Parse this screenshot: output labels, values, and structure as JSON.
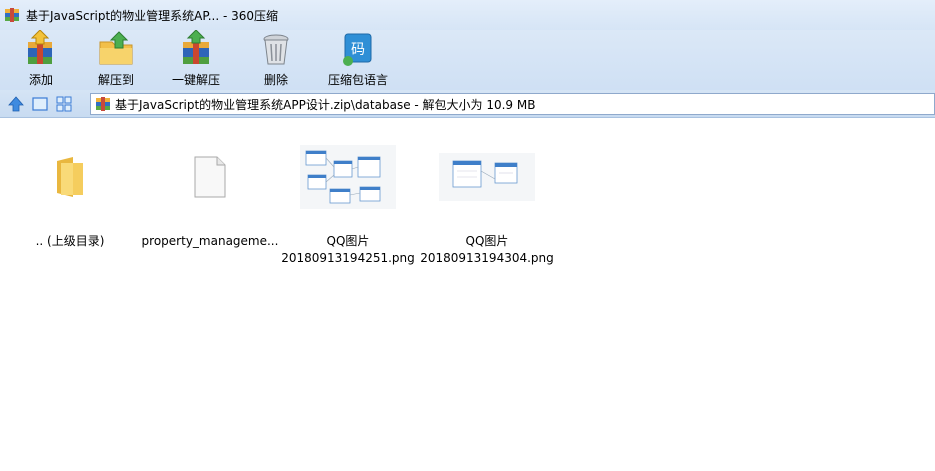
{
  "window": {
    "title": "基于JavaScript的物业管理系统AP... - 360压缩"
  },
  "toolbar": {
    "items": [
      {
        "label": "添加",
        "icon": "add-archive-icon"
      },
      {
        "label": "解压到",
        "icon": "extract-to-icon"
      },
      {
        "label": "一键解压",
        "icon": "one-click-extract-icon"
      },
      {
        "label": "删除",
        "icon": "delete-icon"
      },
      {
        "label": "压缩包语言",
        "icon": "archive-language-icon"
      }
    ]
  },
  "address": {
    "path": "基于JavaScript的物业管理系统APP设计.zip\\database - 解包大小为 10.9 MB"
  },
  "files": [
    {
      "line1": ".. (上级目录)",
      "line2": "",
      "type": "folder"
    },
    {
      "line1": "property_manageme...",
      "line2": "",
      "type": "document"
    },
    {
      "line1": "QQ图片",
      "line2": "20180913194251.png",
      "type": "image"
    },
    {
      "line1": "QQ图片",
      "line2": "20180913194304.png",
      "type": "image"
    }
  ],
  "colors": {
    "toolbar_bg": "#d6e5f6",
    "address_border": "#8fa9cc",
    "folder_yellow": "#f5cd5e",
    "nav_blue": "#3f8be0"
  }
}
